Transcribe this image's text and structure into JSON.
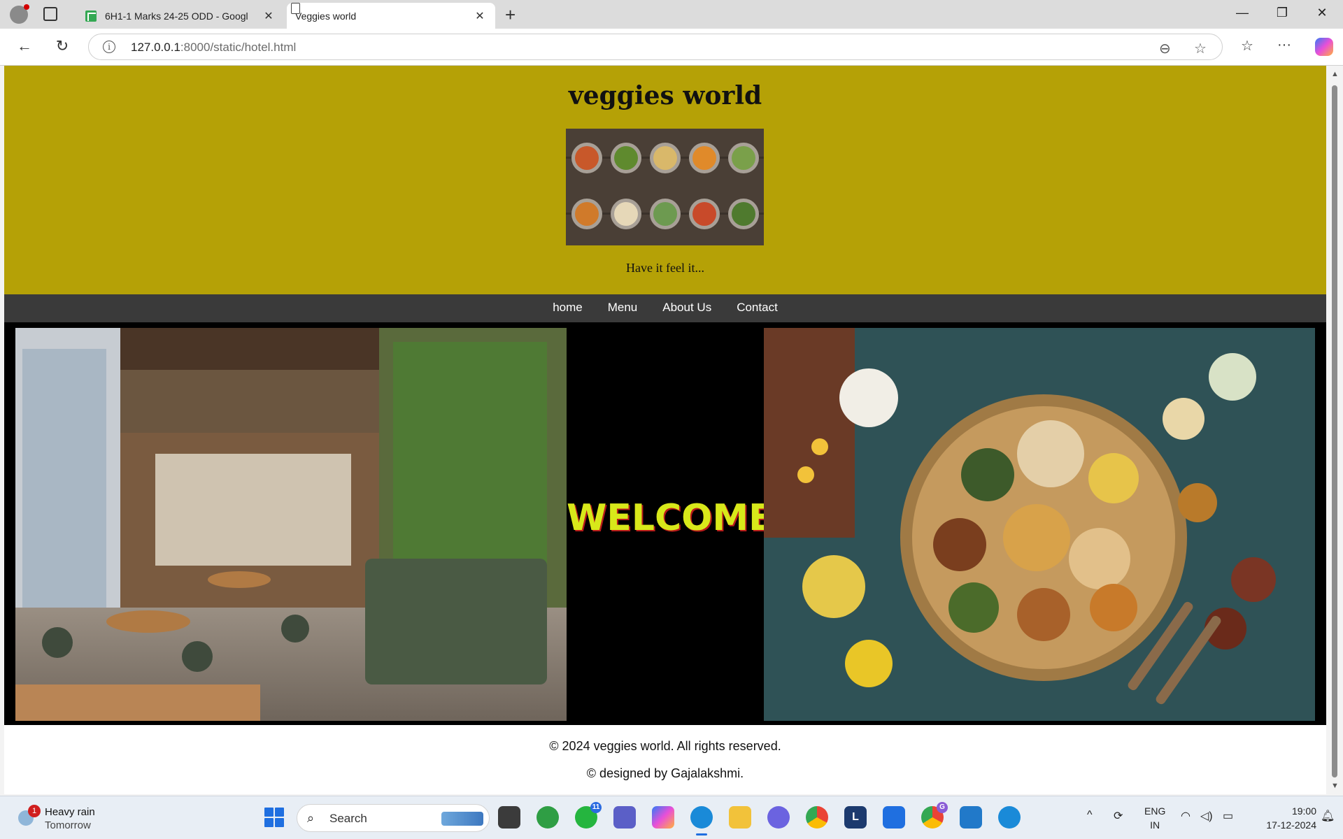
{
  "browser": {
    "tabs": [
      {
        "title": "6H1-1 Marks 24-25 ODD - Googl",
        "active": false
      },
      {
        "title": "Veggies world",
        "active": true
      }
    ],
    "url_host": "127.0.0.1",
    "url_rest": ":8000/static/hotel.html",
    "close_glyph": "✕",
    "newtab_glyph": "+",
    "minimize_glyph": "—",
    "restore_glyph": "❐",
    "window_close_glyph": "✕",
    "back_glyph": "←",
    "reload_glyph": "↻",
    "info_glyph": "i",
    "zoom_glyph": "⊖",
    "star_glyph": "☆",
    "favorites_glyph": "☆",
    "menu_glyph": "···"
  },
  "site": {
    "title": "veggies world",
    "tagline": "Have it feel it...",
    "nav": [
      "home",
      "Menu",
      "About Us",
      "Contact"
    ],
    "welcome": "WELCOME",
    "footer_line1": "© 2024 veggies world. All rights reserved.",
    "footer_line2": "© designed by Gajalakshmi."
  },
  "taskbar": {
    "weather_title": "Heavy rain",
    "weather_sub": "Tomorrow",
    "weather_badge": "1",
    "search_label": "Search",
    "search_glyph": "⌕",
    "whatsapp_count": "11",
    "chrome_profile_badge": "G",
    "l_app_label": "L",
    "lang_line1": "ENG",
    "lang_line2": "IN",
    "time": "19:00",
    "date": "17-12-2024",
    "tray_up_glyph": "^",
    "tray_wifi_glyph": "◠",
    "tray_sound_glyph": "◁)",
    "tray_battery_glyph": "▭"
  },
  "colors": {
    "header_bg": "#b5a106",
    "nav_bg": "#3a3a3a",
    "band_bg": "#000000",
    "welcome_text": "#d8e81a",
    "welcome_shadow": "#b81b1b"
  },
  "icons": [
    "profile-icon",
    "tab-actions-icon",
    "sheets-favicon-icon",
    "page-favicon-icon",
    "back-icon",
    "reload-icon",
    "info-icon",
    "zoom-out-icon",
    "favorite-star-icon",
    "favorites-icon",
    "more-icon",
    "copilot-icon",
    "windows-start-icon",
    "search-icon",
    "wifi-icon",
    "speaker-icon",
    "battery-icon"
  ]
}
